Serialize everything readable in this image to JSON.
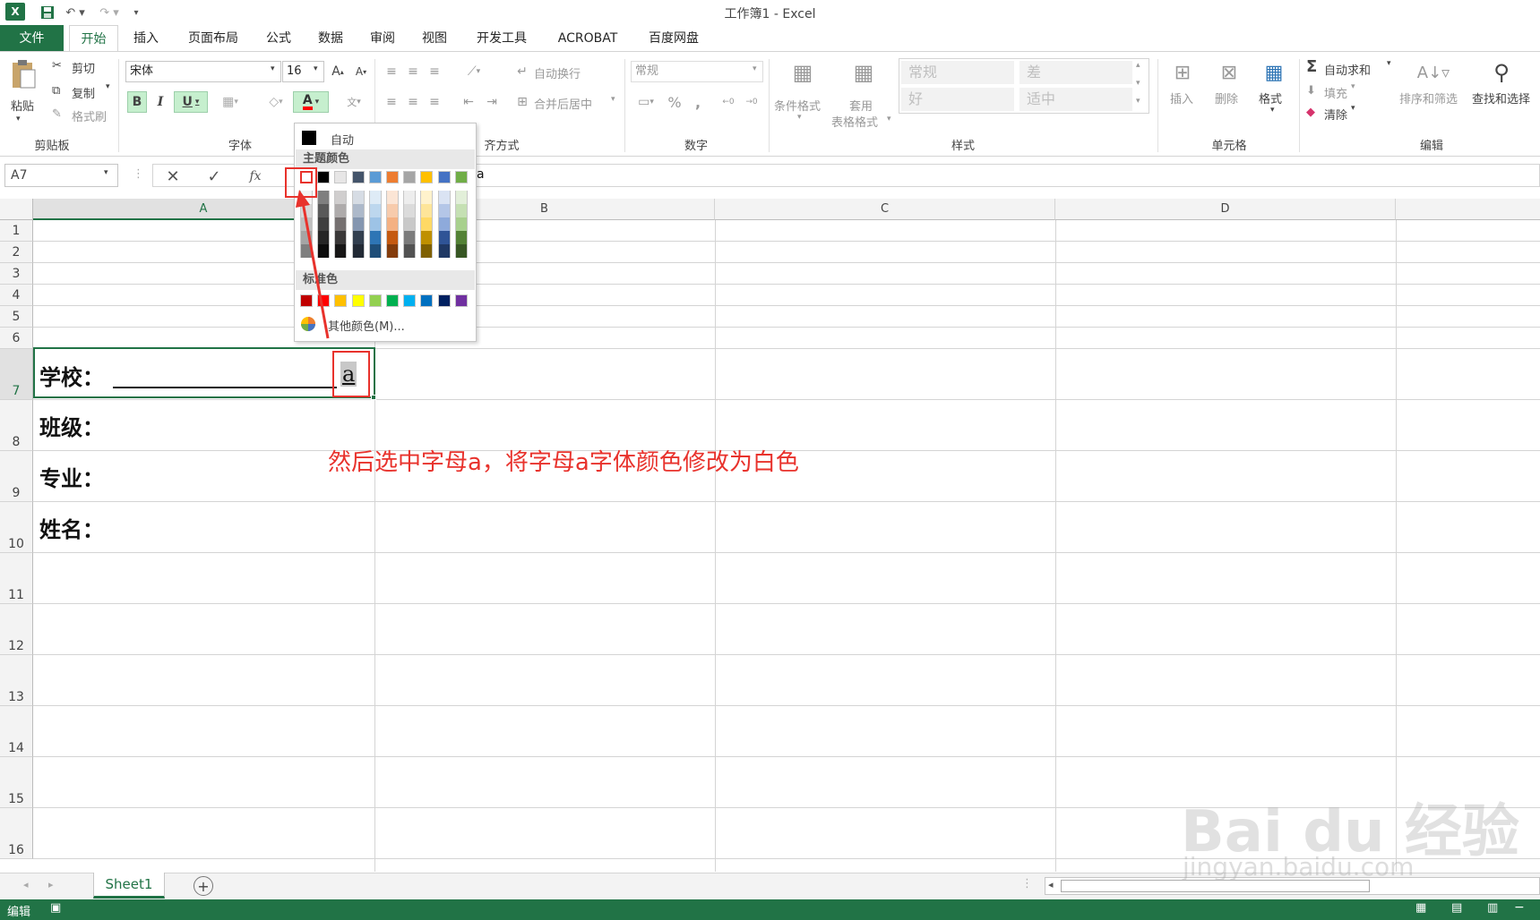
{
  "window": {
    "title": "工作簿1 - Excel"
  },
  "tabs": [
    {
      "label": "文件"
    },
    {
      "label": "开始"
    },
    {
      "label": "插入"
    },
    {
      "label": "页面布局"
    },
    {
      "label": "公式"
    },
    {
      "label": "数据"
    },
    {
      "label": "审阅"
    },
    {
      "label": "视图"
    },
    {
      "label": "开发工具"
    },
    {
      "label": "ACROBAT"
    },
    {
      "label": "百度网盘"
    }
  ],
  "ribbon": {
    "clipboard": {
      "paste": "粘贴",
      "cut": "剪切",
      "copy": "复制",
      "format_painter": "格式刷",
      "label": "剪贴板"
    },
    "font": {
      "name": "宋体",
      "size": "16",
      "bold": "B",
      "italic": "I",
      "underline": "U",
      "font_color_glyph": "A",
      "label": "字体"
    },
    "alignment": {
      "wrap": "自动换行",
      "merge": "合并后居中",
      "label": "齐方式"
    },
    "number": {
      "format": "常规",
      "percent": "%",
      "comma": ",",
      "label": "数字"
    },
    "styles": {
      "conditional": "条件格式",
      "table_top": "套用",
      "table_bottom": "表格格式",
      "normal": "常规",
      "bad": "差",
      "good": "好",
      "neutral": "适中",
      "label": "样式"
    },
    "cells": {
      "insert": "插入",
      "delete": "删除",
      "format": "格式",
      "label": "单元格"
    },
    "editing": {
      "autosum": "自动求和",
      "fill": "填充",
      "clear": "清除",
      "sort": "排序和筛选",
      "find": "查找和选择",
      "label": "编辑"
    }
  },
  "formula_bar": {
    "name_box": "A7",
    "fx": "fx",
    "content": "a"
  },
  "columns": [
    "A",
    "B",
    "C",
    "D"
  ],
  "rows": [
    "1",
    "2",
    "3",
    "4",
    "5",
    "6",
    "7",
    "8",
    "9",
    "10",
    "11",
    "12",
    "13",
    "14",
    "15",
    "16"
  ],
  "cells": {
    "a7_label": "学校：",
    "a7_tail": "a",
    "a8": "班级：",
    "a9": "专业：",
    "a10": "姓名："
  },
  "color_picker": {
    "auto": "自动",
    "theme_header": "主题颜色",
    "standard_header": "标准色",
    "more": "其他颜色(M)...",
    "theme_top": [
      "#ffffff",
      "#000000",
      "#e7e6e6",
      "#44546a",
      "#5b9bd5",
      "#ed7d31",
      "#a5a5a5",
      "#ffc000",
      "#4472c4",
      "#70ad47"
    ],
    "theme_shades": [
      [
        "#f2f2f2",
        "#7f7f7f",
        "#d0cece",
        "#d6dce4",
        "#deebf6",
        "#fbe5d5",
        "#ededed",
        "#fff2cc",
        "#dae3f3",
        "#e2efd9"
      ],
      [
        "#d8d8d8",
        "#595959",
        "#aeabab",
        "#adb9ca",
        "#bdd7ee",
        "#f7cbac",
        "#dbdbdb",
        "#fee599",
        "#b4c6e7",
        "#c5e0b3"
      ],
      [
        "#bfbfbf",
        "#3f3f3f",
        "#757070",
        "#8496b0",
        "#9dc3e6",
        "#f4b183",
        "#c9c9c9",
        "#ffd965",
        "#8eaadb",
        "#a8d08d"
      ],
      [
        "#a5a5a5",
        "#262626",
        "#3a3838",
        "#323f4f",
        "#2e75b5",
        "#c55a11",
        "#7b7b7b",
        "#bf9000",
        "#2f5496",
        "#538135"
      ],
      [
        "#7f7f7f",
        "#0c0c0c",
        "#171616",
        "#222a35",
        "#1e4e79",
        "#843c0b",
        "#525252",
        "#7f6000",
        "#1f3864",
        "#375623"
      ]
    ],
    "standard": [
      "#c00000",
      "#ff0000",
      "#ffc000",
      "#ffff00",
      "#92d050",
      "#00b050",
      "#00b0f0",
      "#0070c0",
      "#002060",
      "#7030a0"
    ]
  },
  "annotation": "然后选中字母a，将字母a字体颜色修改为白色",
  "sheet_tabs": [
    {
      "label": "Sheet1"
    }
  ],
  "status": {
    "mode": "编辑"
  },
  "watermark": {
    "brand": "Bai du 经验",
    "url": "jingyan.baidu.com"
  },
  "colors": {
    "excel_green": "#217346",
    "annotation_red": "#e8322c"
  }
}
